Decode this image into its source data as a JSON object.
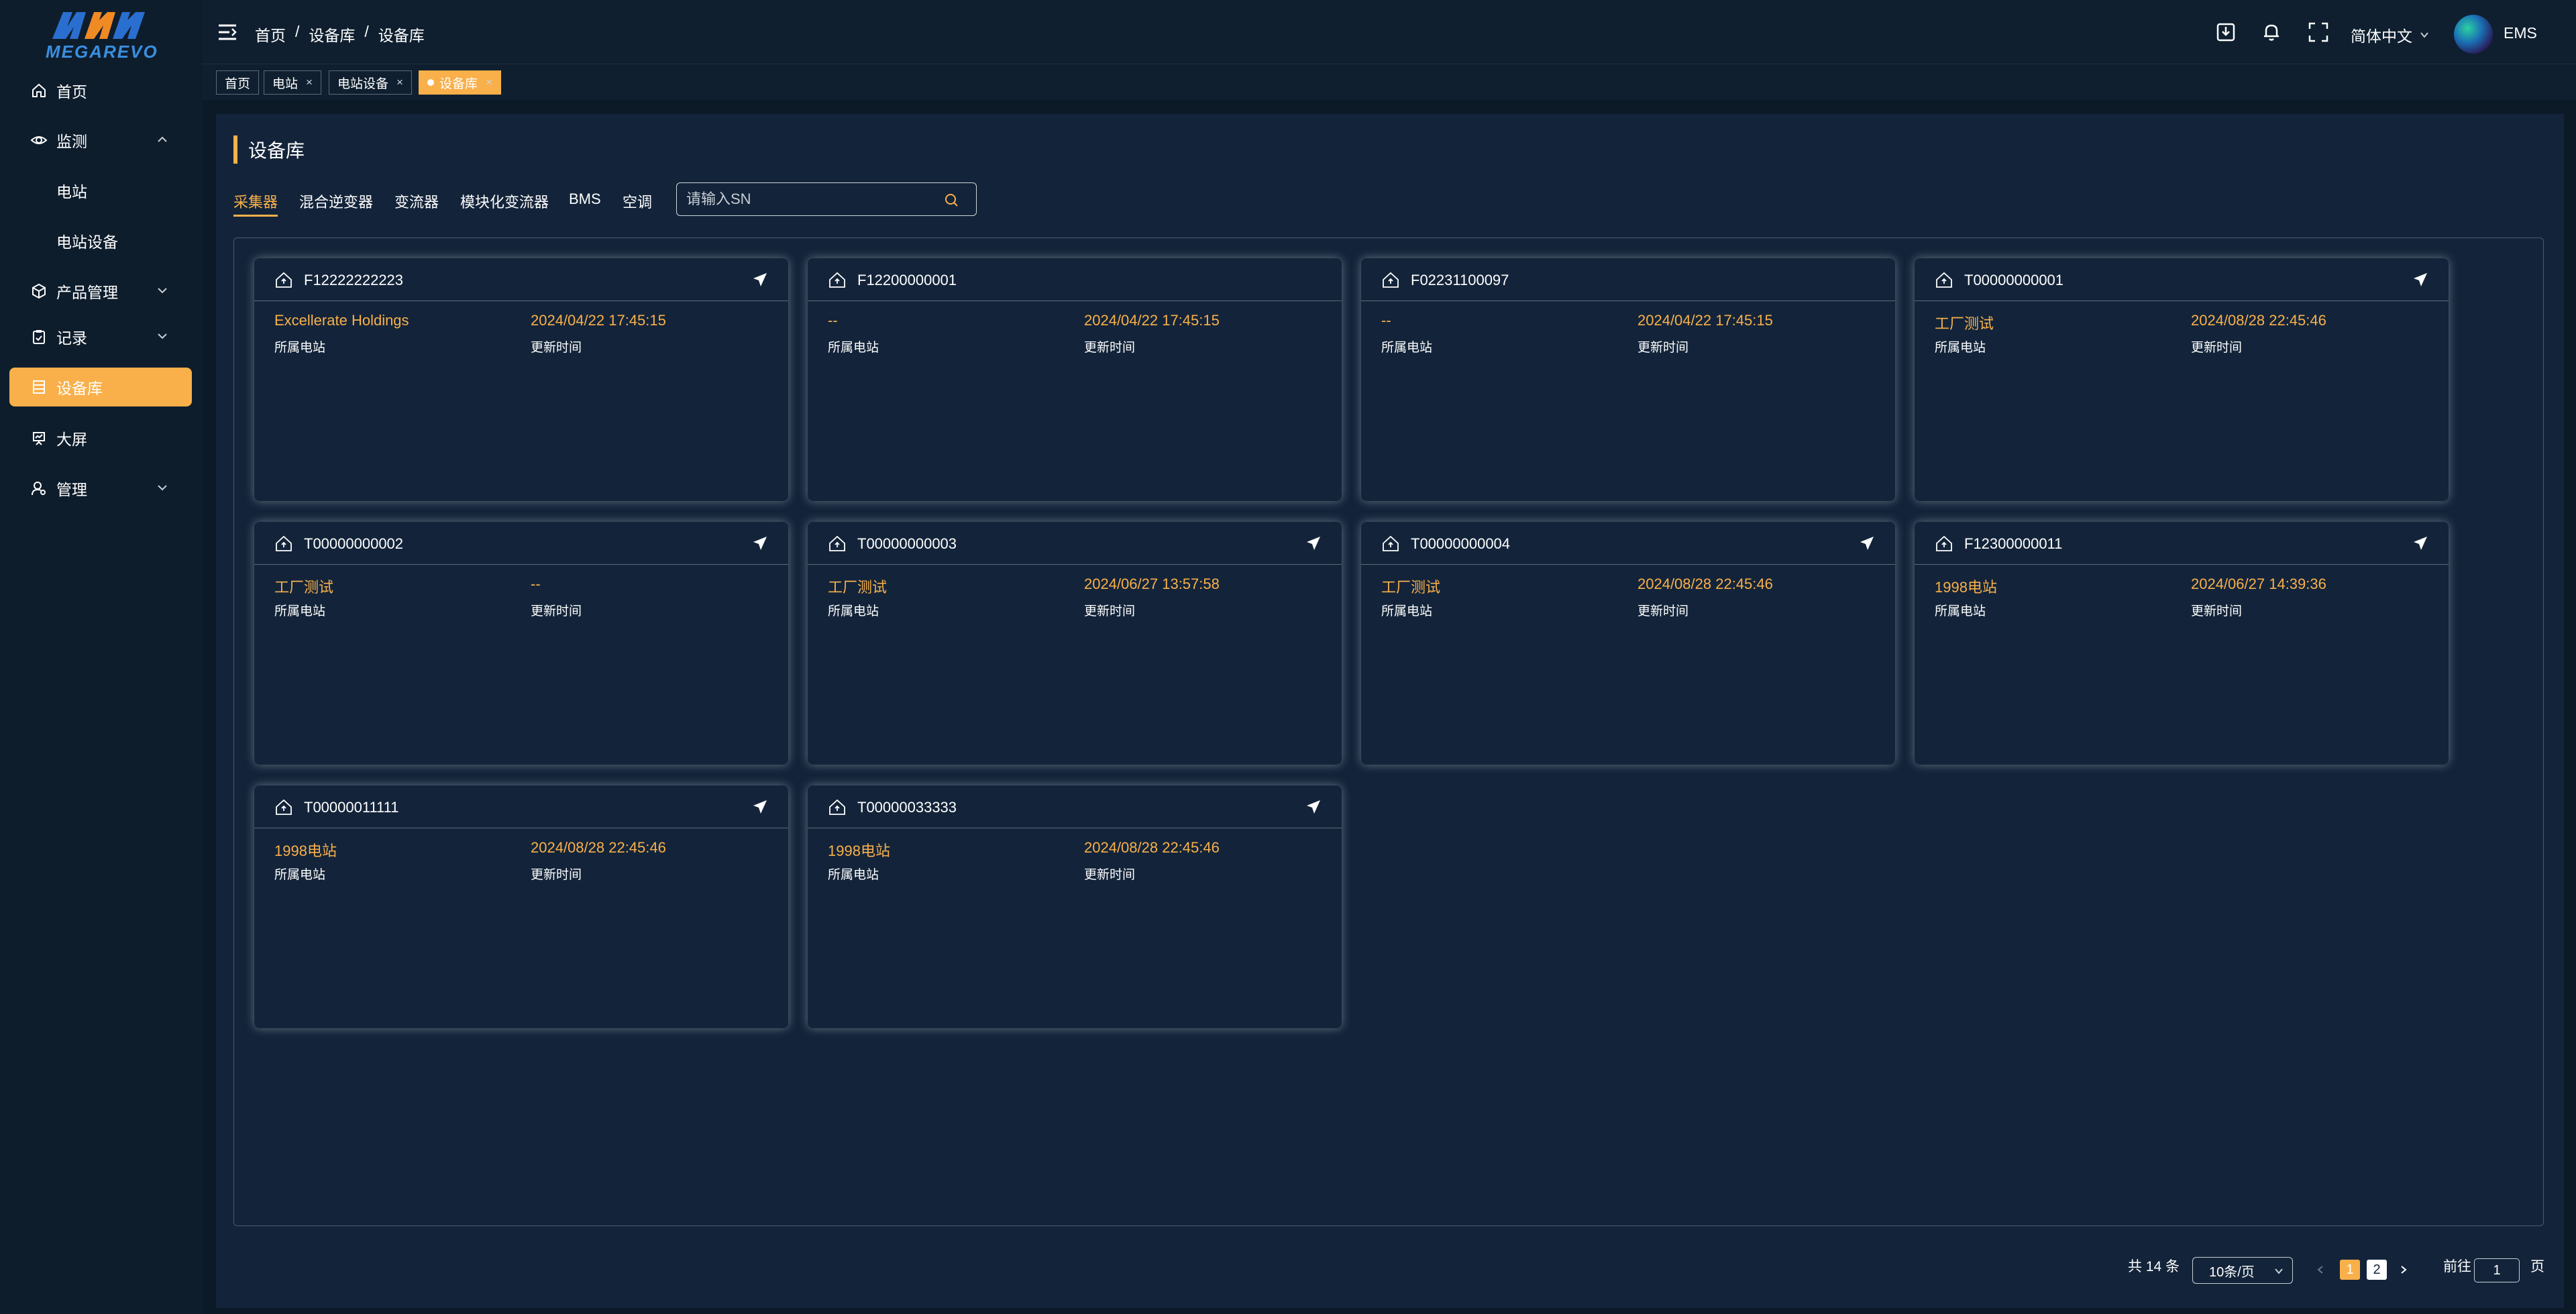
{
  "brand": {
    "logo_text": "MEGAREVO",
    "colors": {
      "accent": "#f9b04a",
      "logo_blue": "#2a6fd0",
      "logo_orange": "#f08a24",
      "bg": "#0c1a28",
      "panel": "#13243a"
    }
  },
  "sidebar": {
    "items": [
      {
        "label": "首页",
        "icon": "home-icon"
      },
      {
        "label": "监测",
        "icon": "eye-icon",
        "expanded": true
      },
      {
        "label": "电站"
      },
      {
        "label": "电站设备"
      },
      {
        "label": "产品管理",
        "icon": "cube-icon"
      },
      {
        "label": "记录",
        "icon": "clipboard-icon"
      },
      {
        "label": "设备库",
        "icon": "database-icon",
        "active": true
      },
      {
        "label": "大屏",
        "icon": "screen-chart-icon"
      },
      {
        "label": "管理",
        "icon": "user-settings-icon"
      }
    ]
  },
  "header": {
    "breadcrumb": [
      "首页",
      "设备库",
      "设备库"
    ],
    "breadcrumb_sep": "/",
    "language": "简体中文",
    "user": "EMS"
  },
  "tabs": [
    {
      "label": "首页"
    },
    {
      "label": "电站",
      "close": "×"
    },
    {
      "label": "电站设备",
      "close": "×"
    },
    {
      "label": "设备库",
      "close": "×",
      "active": true
    }
  ],
  "page": {
    "title": "设备库",
    "type_tabs": [
      "采集器",
      "混合逆变器",
      "变流器",
      "模块化变流器",
      "BMS",
      "空调"
    ],
    "active_type_tab": 0,
    "search_placeholder": "请输入SN",
    "field_label_station": "所属电站",
    "field_label_updated": "更新时间"
  },
  "devices": [
    {
      "sn": "F12222222223",
      "station": "Excellerate Holdings",
      "updated": "2024/04/22 17:45:15"
    },
    {
      "sn": "F12200000001",
      "station": "--",
      "updated": "2024/04/22 17:45:15"
    },
    {
      "sn": "F02231100097",
      "station": "--",
      "updated": "2024/04/22 17:45:15"
    },
    {
      "sn": "T00000000001",
      "station": "工厂测试",
      "updated": "2024/08/28 22:45:46"
    },
    {
      "sn": "T00000000002",
      "station": "工厂测试",
      "updated": "--"
    },
    {
      "sn": "T00000000003",
      "station": "工厂测试",
      "updated": "2024/06/27 13:57:58"
    },
    {
      "sn": "T00000000004",
      "station": "工厂测试",
      "updated": "2024/08/28 22:45:46"
    },
    {
      "sn": "F12300000011",
      "station": "1998电站",
      "updated": "2024/06/27 14:39:36"
    },
    {
      "sn": "T00000011111",
      "station": "1998电站",
      "updated": "2024/08/28 22:45:46"
    },
    {
      "sn": "T00000033333",
      "station": "1998电站",
      "updated": "2024/08/28 22:45:46"
    }
  ],
  "pagination": {
    "total_text": "共 14 条",
    "page_size": "10条/页",
    "pages": [
      "1",
      "2"
    ],
    "current_page": "1",
    "goto_label": "前往",
    "goto_value": "1",
    "goto_suffix": "页"
  }
}
